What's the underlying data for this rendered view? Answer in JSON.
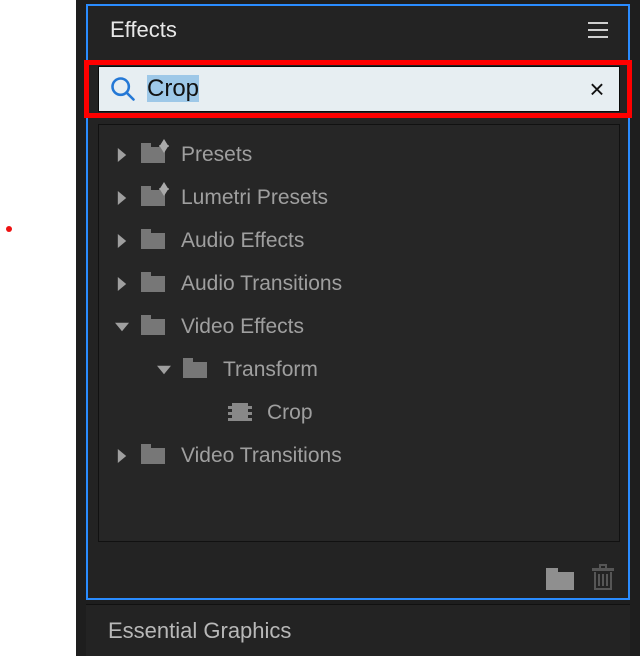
{
  "panel": {
    "title": "Effects",
    "menu_icon": "hamburger-icon"
  },
  "search": {
    "icon": "search-icon",
    "value": "Crop",
    "placeholder": "",
    "clear_label": "×"
  },
  "tree": [
    {
      "expanded": false,
      "indent": 0,
      "icon": "folder-star",
      "label": "Presets"
    },
    {
      "expanded": false,
      "indent": 0,
      "icon": "folder-star",
      "label": "Lumetri Presets"
    },
    {
      "expanded": false,
      "indent": 0,
      "icon": "folder",
      "label": "Audio Effects"
    },
    {
      "expanded": false,
      "indent": 0,
      "icon": "folder",
      "label": "Audio Transitions"
    },
    {
      "expanded": true,
      "indent": 0,
      "icon": "folder",
      "label": "Video Effects"
    },
    {
      "expanded": true,
      "indent": 1,
      "icon": "folder",
      "label": "Transform"
    },
    {
      "expanded": null,
      "indent": 2,
      "icon": "effect",
      "label": "Crop"
    },
    {
      "expanded": false,
      "indent": 0,
      "icon": "folder",
      "label": "Video Transitions"
    }
  ],
  "footer": {
    "new_bin": "new-bin-icon",
    "delete": "trash-icon"
  },
  "secondary_panel": {
    "title": "Essential Graphics"
  }
}
